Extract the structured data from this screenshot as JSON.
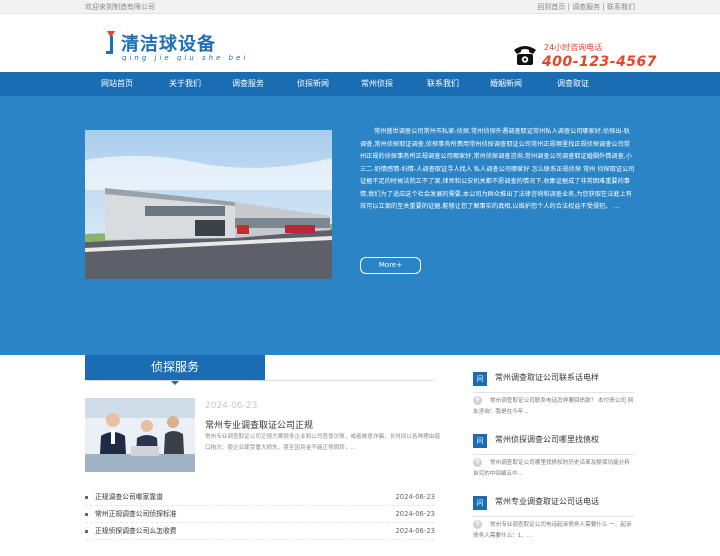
{
  "topbar": {
    "welcome": "欢迎来到制造有限公司",
    "links": [
      "回到首页",
      "调查服务",
      "联系我们"
    ],
    "separator": " | "
  },
  "logo": {
    "name": "清洁球设备",
    "pinyin": "qing jie qiu she bei",
    "brand_color": "#1f6fb8"
  },
  "hotline": {
    "label": "24小时咨询电话",
    "number": "400-123-4567",
    "color": "#e8442a",
    "icon": "phone-icon"
  },
  "nav": {
    "color": "#1a6db3",
    "items": [
      "网站首页",
      "关于我们",
      "调查服务",
      "侦探新闻",
      "常州侦探",
      "联系我们",
      "婚姻新闻",
      "调查取证"
    ]
  },
  "hero": {
    "background": "#2a84c6",
    "text": "常州盛世调查公司常州市私家-侦探,常州侦探外遇调查取证常州私人调查公司哪家好,侦探出-轨调查,常州侦探取证调查,侦探事务所费用常州侦探调查取证公司常州正规哪里找正规侦探调查公司常州正规的侦探事务所正规调查公司哪家好,常州侦探调查咨询,常州调查公司调查取证婚姻外情调查,小三二-奶情感情-妇情-人调查取证寻人找人 私人调查公司哪家好 怎么联系正规侦探 常州 侦探取证公司 证据不足的时候法院立不了案,律师和公安机关都不愿调查的情况下,收集证据成了非常困难重要的事情,我们为了适应这个社会发展的需要,本公司为群众推出了法律咨询和调查业务,为您获取在法庭上有效可以立案的至关重要的证据,能够让您了解事实的真相,以维护您个人的合法权益不受侵犯。 ...",
    "more_label": "More+"
  },
  "news": {
    "header": "侦探服务",
    "featured": {
      "date": "2024-06-23",
      "title": "常州专业调查取证公司正规",
      "desc": "常州专业调查取证公司正规方案很多企业和公司恶意欠账，或者故意诈骗，长时间以各种理由借口拖欠，使企业蒙受重大损失，甚至因资金不能正常周转，..."
    },
    "list": [
      {
        "title": "正规调查公司哪家靠谱",
        "date": "2024-06-23"
      },
      {
        "title": "常州正规调查公司侦探标准",
        "date": "2024-06-23"
      },
      {
        "title": "正规侦探调查公司么怎收费",
        "date": "2024-06-23"
      }
    ]
  },
  "faq": {
    "q_icon_label": "问",
    "a_icon_label": "答",
    "items": [
      {
        "q": "常州调查取证公司联系话电样",
        "a": "常州调查取证公司联系电话怎样要回债款？ 本付债公司 网友咨询：我是在今年..."
      },
      {
        "q": "常州侦探调查公司哪里找债权",
        "a": "常州调查取证公司哪里找债权的历史沿革及损保功能分析 自究的中回编五中..."
      },
      {
        "q": "常州专业调查取证公司话电话",
        "a": "常州专业调查取证公司电话起诉债务人需要什么 一、起诉债务人需要什么：1、..."
      }
    ]
  }
}
